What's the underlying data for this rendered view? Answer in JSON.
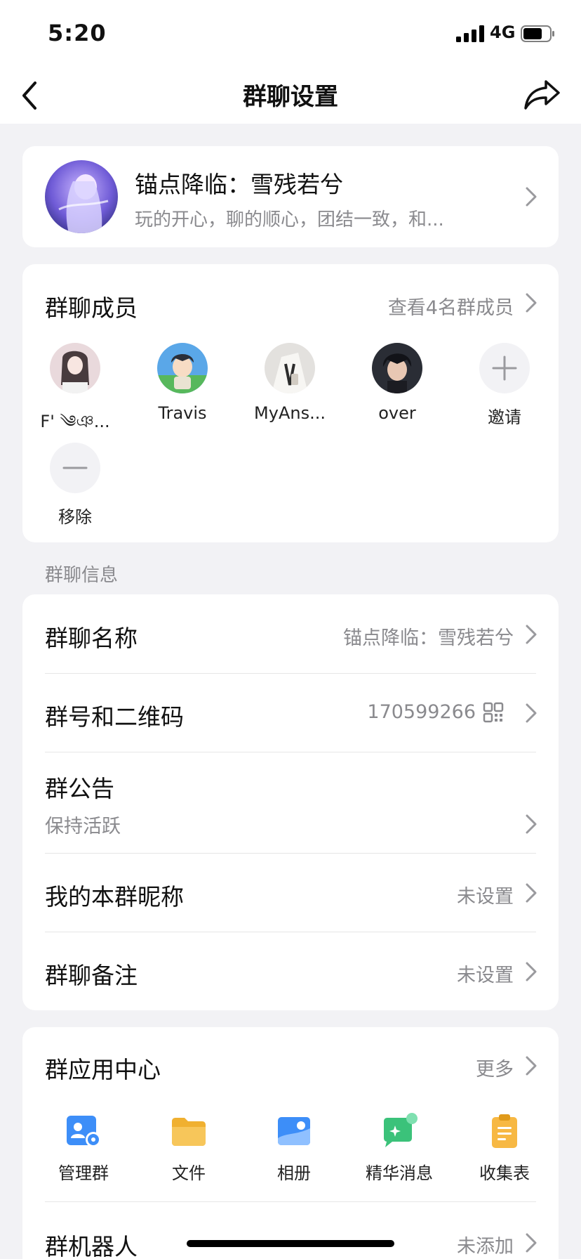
{
  "status_bar": {
    "time": "5:20",
    "network": "4G"
  },
  "nav": {
    "title": "群聊设置",
    "back_icon": "chevron-left-icon",
    "share_icon": "share-arrow-icon"
  },
  "group": {
    "name": "锚点降临：雪残若兮",
    "description": "玩的开心，聊的顺心，团结一致，和..."
  },
  "members": {
    "title": "群聊成员",
    "view_all": "查看4名群成员",
    "list": [
      {
        "name": "F' ༄ঞ..."
      },
      {
        "name": "Travis"
      },
      {
        "name": "MyAns..."
      },
      {
        "name": "over"
      }
    ],
    "invite_label": "邀请",
    "remove_label": "移除"
  },
  "info": {
    "section_label": "群聊信息",
    "name_title": "群聊名称",
    "name_value": "锚点降临：雪残若兮",
    "number_title": "群号和二维码",
    "number_value": "170599266",
    "notice_title": "群公告",
    "notice_value": "保持活跃",
    "nickname_title": "我的本群昵称",
    "nickname_value": "未设置",
    "remark_title": "群聊备注",
    "remark_value": "未设置"
  },
  "apps": {
    "title": "群应用中心",
    "more": "更多",
    "items": [
      {
        "label": "管理群",
        "icon": "manage-group-icon",
        "color": "#3d8ef8"
      },
      {
        "label": "文件",
        "icon": "folder-icon",
        "color": "#f7b843"
      },
      {
        "label": "相册",
        "icon": "album-icon",
        "color": "#3d8ef8"
      },
      {
        "label": "精华消息",
        "icon": "highlight-message-icon",
        "color": "#3bc27a"
      },
      {
        "label": "收集表",
        "icon": "clipboard-icon",
        "color": "#f7b843"
      }
    ],
    "robot_title": "群机器人",
    "robot_value": "未添加"
  }
}
